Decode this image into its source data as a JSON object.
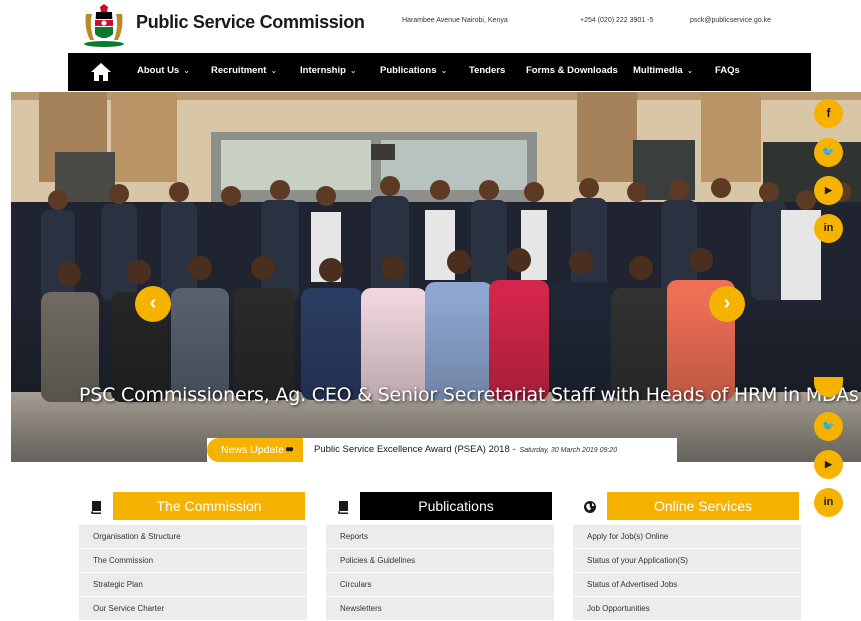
{
  "header": {
    "site_title": "Public Service Commission",
    "address": "Harambee Avenue Nairobi, Kenya",
    "phone": "+254 (020) 222 3901 -5",
    "email": "psck@publicservice.go.ke",
    "logo_icon": "kenya-coat-of-arms-icon"
  },
  "nav": {
    "home_icon": "home-icon",
    "items": [
      {
        "label": "About Us",
        "dropdown": true
      },
      {
        "label": "Recruitment",
        "dropdown": true
      },
      {
        "label": "Internship",
        "dropdown": true
      },
      {
        "label": "Publications",
        "dropdown": true
      },
      {
        "label": "Tenders",
        "dropdown": false
      },
      {
        "label": "Forms & Downloads",
        "dropdown": false
      },
      {
        "label": "Multimedia",
        "dropdown": true
      },
      {
        "label": "FAQs",
        "dropdown": false
      }
    ]
  },
  "hero": {
    "caption": "PSC Commissioners, Ag. CEO & Senior Secretariat Staff with Heads of HRM in MDAs",
    "prev_label": "‹",
    "next_label": "›"
  },
  "social_top": [
    {
      "icon": "facebook-icon",
      "glyph": "f"
    },
    {
      "icon": "twitter-icon",
      "glyph": "🐦"
    },
    {
      "icon": "youtube-icon",
      "glyph": "▶"
    },
    {
      "icon": "linkedin-icon",
      "glyph": "in"
    }
  ],
  "social_side": [
    {
      "icon": "twitter-icon",
      "glyph": "🐦"
    },
    {
      "icon": "youtube-icon",
      "glyph": "▶"
    },
    {
      "icon": "linkedin-icon",
      "glyph": "in"
    }
  ],
  "news": {
    "label": "News Update",
    "headline": "Public Service Excellence Award (PSEA) 2018 -",
    "date": "Saturday, 30 March 2019 09:20"
  },
  "columns": [
    {
      "title": "The Commission",
      "icon": "book-icon",
      "style": "yellow",
      "items": [
        "Organisation & Structure",
        "The Commission",
        "Strategic Plan",
        "Our Service Charter"
      ]
    },
    {
      "title": "Publications",
      "icon": "book-icon",
      "style": "black",
      "items": [
        "Reports",
        "Policies & Guidelines",
        "Circulars",
        "Newsletters"
      ]
    },
    {
      "title": "Online Services",
      "icon": "globe-icon",
      "style": "yellow",
      "items": [
        "Apply for Job(s) Online",
        "Status of your Application(S)",
        "Status of Advertised Jobs",
        "Job Opportunities"
      ]
    }
  ],
  "colors": {
    "accent": "#f5b300",
    "nav_bg": "#000000",
    "list_bg": "#ececec"
  }
}
